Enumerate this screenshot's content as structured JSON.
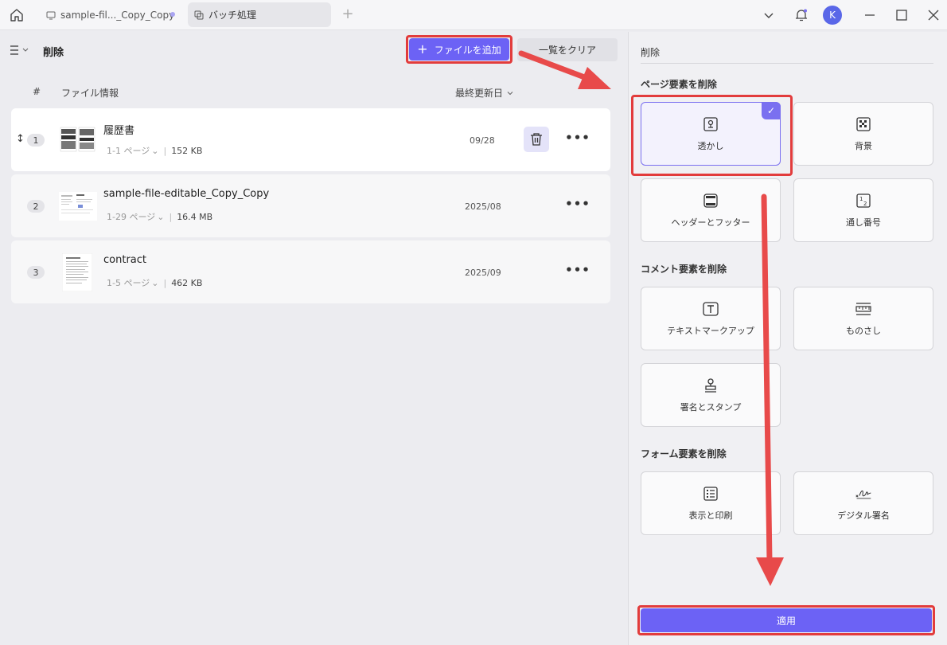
{
  "tabs": [
    {
      "label": "sample-fil..._Copy_Copy"
    },
    {
      "label": "バッチ処理"
    }
  ],
  "user": {
    "avatar_letter": "K"
  },
  "header": {
    "title": "削除",
    "add_files_label": "ファイルを追加",
    "clear_list_label": "一覧をクリア"
  },
  "table": {
    "col_num": "#",
    "col_info": "ファイル情報",
    "col_date": "最終更新日"
  },
  "files": [
    {
      "num": "1",
      "name": "履歴書",
      "pages": "1-1 ページ",
      "size": "152 KB",
      "date": "09/28"
    },
    {
      "num": "2",
      "name": "sample-file-editable_Copy_Copy",
      "pages": "1-29 ページ",
      "size": "16.4 MB",
      "date": "2025/08"
    },
    {
      "num": "3",
      "name": "contract",
      "pages": "1-5 ページ",
      "size": "462 KB",
      "date": "2025/09"
    }
  ],
  "panel": {
    "title": "削除",
    "section_page": "ページ要素を削除",
    "section_comment": "コメント要素を削除",
    "section_form": "フォーム要素を削除",
    "cards": {
      "watermark": "透かし",
      "background": "背景",
      "header_footer": "ヘッダーとフッター",
      "bates": "通し番号",
      "text_markup": "テキストマークアップ",
      "measure": "ものさし",
      "signature_stamp": "署名とスタンプ",
      "display_print": "表示と印刷",
      "digital_signature": "デジタル署名"
    },
    "apply_label": "適用"
  },
  "colors": {
    "accent": "#6c62f5",
    "highlight": "#e23c3c"
  }
}
